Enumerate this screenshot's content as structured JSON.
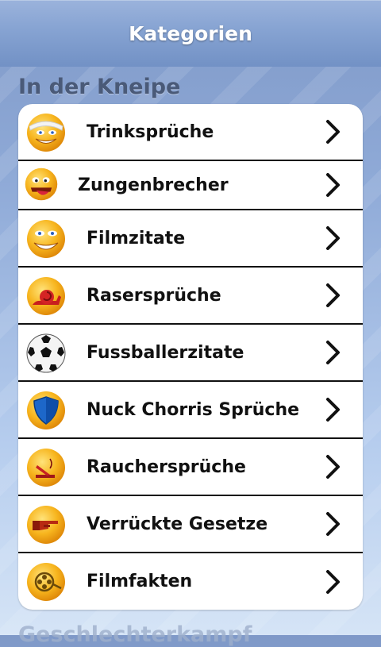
{
  "header": {
    "title": "Kategorien"
  },
  "sections": [
    {
      "title": "In der Kneipe",
      "items": [
        {
          "label": "Trinksprüche",
          "icon": "bandaged-smiley-icon"
        },
        {
          "label": "Zungenbrecher",
          "icon": "tongue-smiley-icon"
        },
        {
          "label": "Filmzitate",
          "icon": "grinning-smiley-icon"
        },
        {
          "label": "Rasersprüche",
          "icon": "snail-icon"
        },
        {
          "label": "Fussballerzitate",
          "icon": "soccer-ball-icon"
        },
        {
          "label": "Nuck Chorris Sprüche",
          "icon": "shield-icon"
        },
        {
          "label": "Rauchersprüche",
          "icon": "cigarette-icon"
        },
        {
          "label": "Verrückte Gesetze",
          "icon": "pointing-hand-icon"
        },
        {
          "label": "Filmfakten",
          "icon": "film-reel-icon"
        }
      ]
    },
    {
      "title": "Geschlechterkampf"
    }
  ],
  "colors": {
    "smiley": "#f7b51e",
    "smiley_dark": "#e08b0a",
    "shield": "#1d67c9"
  }
}
